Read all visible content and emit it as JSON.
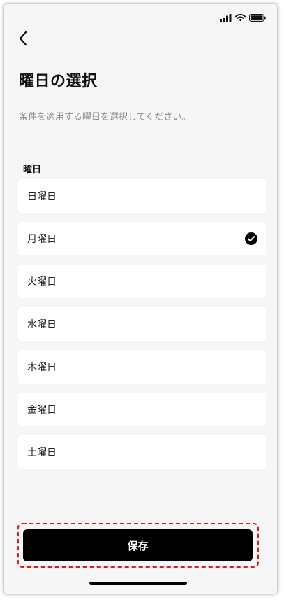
{
  "header": {
    "title": "曜日の選択",
    "description": "条件を適用する曜日を選択してください。"
  },
  "section": {
    "label": "曜日"
  },
  "days": [
    {
      "label": "日曜日",
      "selected": false
    },
    {
      "label": "月曜日",
      "selected": true
    },
    {
      "label": "火曜日",
      "selected": false
    },
    {
      "label": "水曜日",
      "selected": false
    },
    {
      "label": "木曜日",
      "selected": false
    },
    {
      "label": "金曜日",
      "selected": false
    },
    {
      "label": "土曜日",
      "selected": false
    }
  ],
  "footer": {
    "save_label": "保存"
  },
  "icons": {
    "back": "chevron-left-icon",
    "check": "check-circle-icon",
    "signal": "signal-icon",
    "wifi": "wifi-icon",
    "battery": "battery-icon"
  },
  "colors": {
    "background": "#f6f6f6",
    "card": "#ffffff",
    "primary": "#000000",
    "highlight_border": "#e01818",
    "muted_text": "#8a8a8a"
  }
}
